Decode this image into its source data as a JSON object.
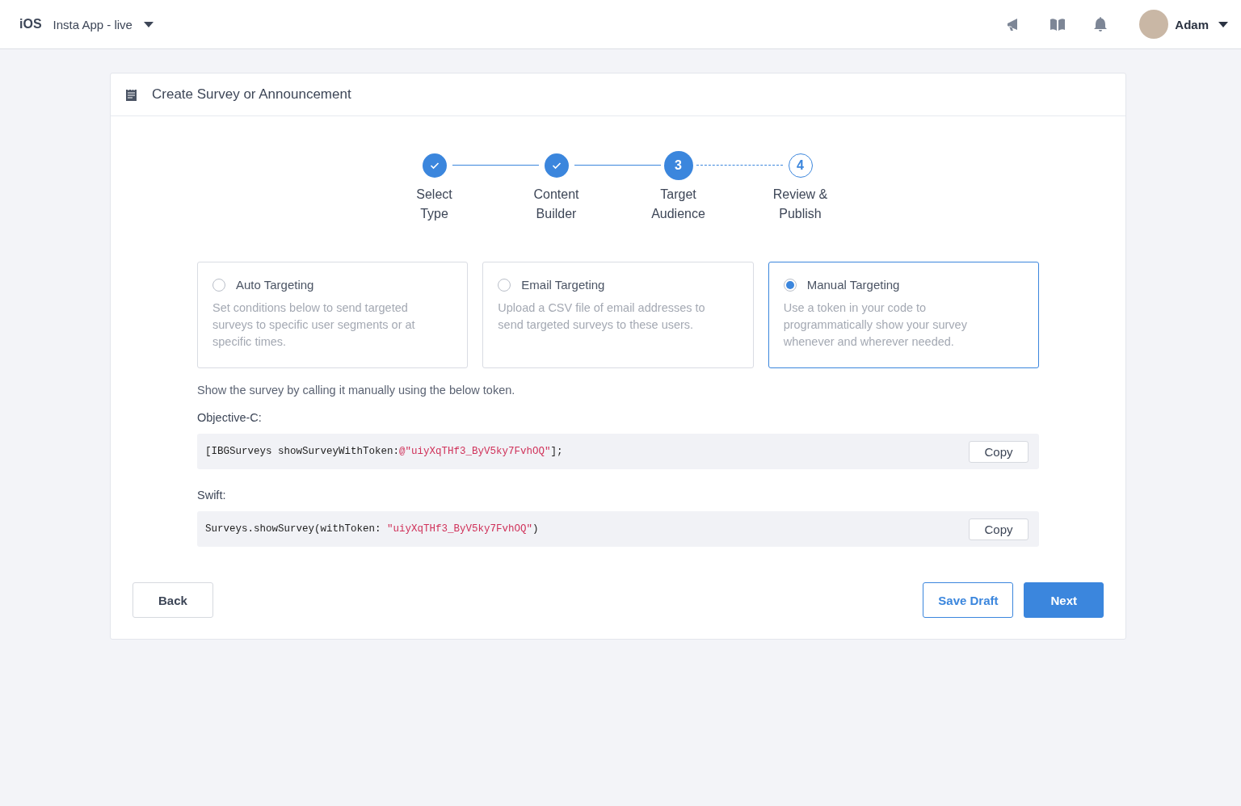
{
  "topbar": {
    "platform": "iOS",
    "app_name": "Insta App - live",
    "user": {
      "name": "Adam"
    }
  },
  "card": {
    "title": "Create Survey or Announcement"
  },
  "steps": [
    {
      "label": "Select\nType",
      "kind": "done"
    },
    {
      "label": "Content\nBuilder",
      "kind": "done"
    },
    {
      "number": "3",
      "label": "Target\nAudience",
      "kind": "current"
    },
    {
      "number": "4",
      "label": "Review &\nPublish",
      "kind": "upcoming"
    }
  ],
  "options": [
    {
      "title": "Auto Targeting",
      "description": "Set conditions below to send targeted surveys to specific user segments or at specific times.",
      "selected": false
    },
    {
      "title": "Email Targeting",
      "description": "Upload a CSV file of email addresses to send targeted surveys to these users.",
      "selected": false
    },
    {
      "title": "Manual Targeting",
      "description": "Use a token in your code to programmatically show your survey whenever and wherever needed.",
      "selected": true
    }
  ],
  "instructions": "Show the survey by calling it manually using the below token.",
  "snippets": [
    {
      "label": "Objective-C:",
      "code": [
        {
          "kind": "plain",
          "text": "[IBGSurveys showSurveyWithToken:"
        },
        {
          "kind": "string",
          "text": "@\"uiyXqTHf3_ByV5ky7FvhOQ\""
        },
        {
          "kind": "plain",
          "text": "];"
        }
      ],
      "button": "Copy"
    },
    {
      "label": "Swift:",
      "code": [
        {
          "kind": "plain",
          "text": "Surveys.showSurvey(withToken: "
        },
        {
          "kind": "string",
          "text": "\"uiyXqTHf3_ByV5ky7FvhOQ\""
        },
        {
          "kind": "plain",
          "text": ")"
        }
      ],
      "button": "Copy"
    }
  ],
  "footer": {
    "back": "Back",
    "save_draft": "Save Draft",
    "next": "Next"
  }
}
